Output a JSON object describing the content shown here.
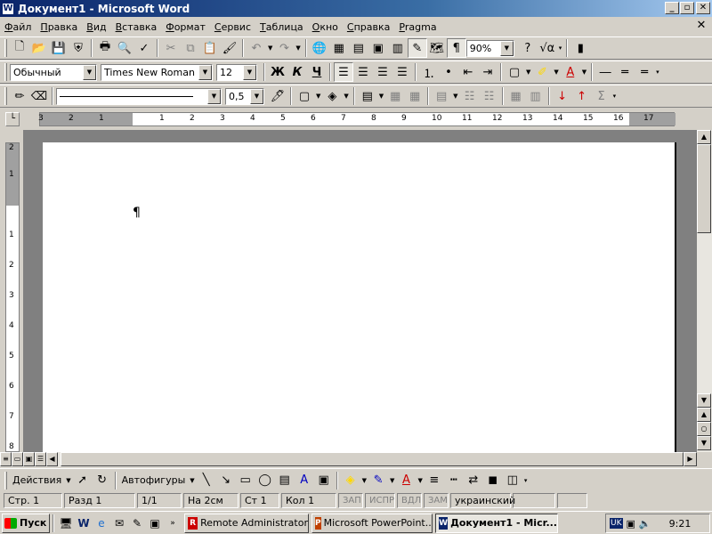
{
  "window": {
    "title": "Документ1 - Microsoft Word",
    "app_icon": "W"
  },
  "menu": [
    "Файл",
    "Правка",
    "Вид",
    "Вставка",
    "Формат",
    "Сервис",
    "Таблица",
    "Окно",
    "Справка",
    "Pragma"
  ],
  "standard": {
    "zoom": "90%"
  },
  "formatting": {
    "style": "Обычный",
    "font": "Times New Roman",
    "size": "12",
    "bold": "Ж",
    "italic": "К",
    "underline": "Ч"
  },
  "borders": {
    "line_weight": "0,5"
  },
  "ruler": {
    "h_labels": [
      "3",
      "2",
      "1",
      "1",
      "2",
      "3",
      "4",
      "5",
      "6",
      "7",
      "8",
      "9",
      "10",
      "11",
      "12",
      "13",
      "14",
      "15",
      "16",
      "17"
    ],
    "v_labels": [
      "2",
      "1",
      "1",
      "2",
      "3",
      "4",
      "5",
      "6",
      "7",
      "8"
    ]
  },
  "document": {
    "paragraph_mark": "¶"
  },
  "drawing": {
    "actions": "Действия",
    "autoshapes": "Автофигуры"
  },
  "status": {
    "page": "Стр. 1",
    "section": "Разд 1",
    "pages": "1/1",
    "at": "На 2см",
    "line": "Ст 1",
    "col": "Кол 1",
    "rec": "ЗАП",
    "trk": "ИСПР",
    "ext": "ВДЛ",
    "ovr": "ЗАМ",
    "language": "украинский"
  },
  "taskbar": {
    "start": "Пуск",
    "tasks": [
      "Remote Administrator",
      "Microsoft PowerPoint...",
      "Документ1 - Micr..."
    ],
    "lang": "UK",
    "clock": "9:21"
  },
  "colors": {
    "title_start": "#0a246a",
    "title_end": "#a6caf0",
    "face": "#d4d0c8"
  }
}
